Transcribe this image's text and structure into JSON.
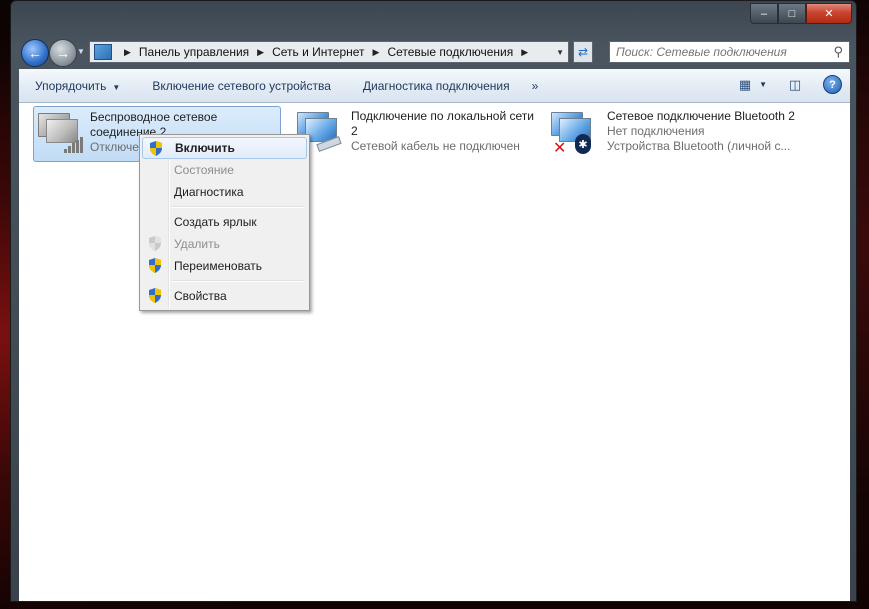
{
  "window": {
    "caption_buttons": {
      "minimize": "–",
      "maximize": "□",
      "close": "✕"
    }
  },
  "nav": {
    "back_icon": "back-arrow-icon",
    "forward_icon": "forward-arrow-icon",
    "breadcrumbs": [
      "Панель управления",
      "Сеть и Интернет",
      "Сетевые подключения"
    ],
    "search_placeholder": "Поиск: Сетевые подключения"
  },
  "toolbar": {
    "organize": "Упорядочить",
    "enable_device": "Включение сетевого устройства",
    "diagnose": "Диагностика подключения",
    "more": "»"
  },
  "connections": [
    {
      "name": "Беспроводное сетевое соединение 2",
      "status": "Отключено",
      "device": "",
      "icon": "wireless-network-icon",
      "selected": true
    },
    {
      "name": "Подключение по локальной сети 2",
      "status": "Сетевой кабель не подключен",
      "device": "",
      "icon": "lan-connection-icon",
      "selected": false
    },
    {
      "name": "Сетевое подключение Bluetooth 2",
      "status": "Нет подключения",
      "device": "Устройства Bluetooth (личной с...",
      "icon": "bluetooth-network-icon",
      "selected": false
    }
  ],
  "context_menu": {
    "items": [
      {
        "label": "Включить",
        "shield": true,
        "bold": true,
        "disabled": false,
        "hover": true
      },
      {
        "label": "Состояние",
        "shield": false,
        "bold": false,
        "disabled": true
      },
      {
        "label": "Диагностика",
        "shield": false,
        "bold": false,
        "disabled": false
      },
      {
        "label": "Создать ярлык",
        "shield": false,
        "bold": false,
        "disabled": false
      },
      {
        "label": "Удалить",
        "shield": true,
        "bold": false,
        "disabled": true
      },
      {
        "label": "Переименовать",
        "shield": true,
        "bold": false,
        "disabled": false
      },
      {
        "label": "Свойства",
        "shield": true,
        "bold": false,
        "disabled": false
      }
    ]
  },
  "colors": {
    "accent": "#1e395b",
    "selection": "#c1dcf5",
    "close_button": "#c8452e"
  }
}
